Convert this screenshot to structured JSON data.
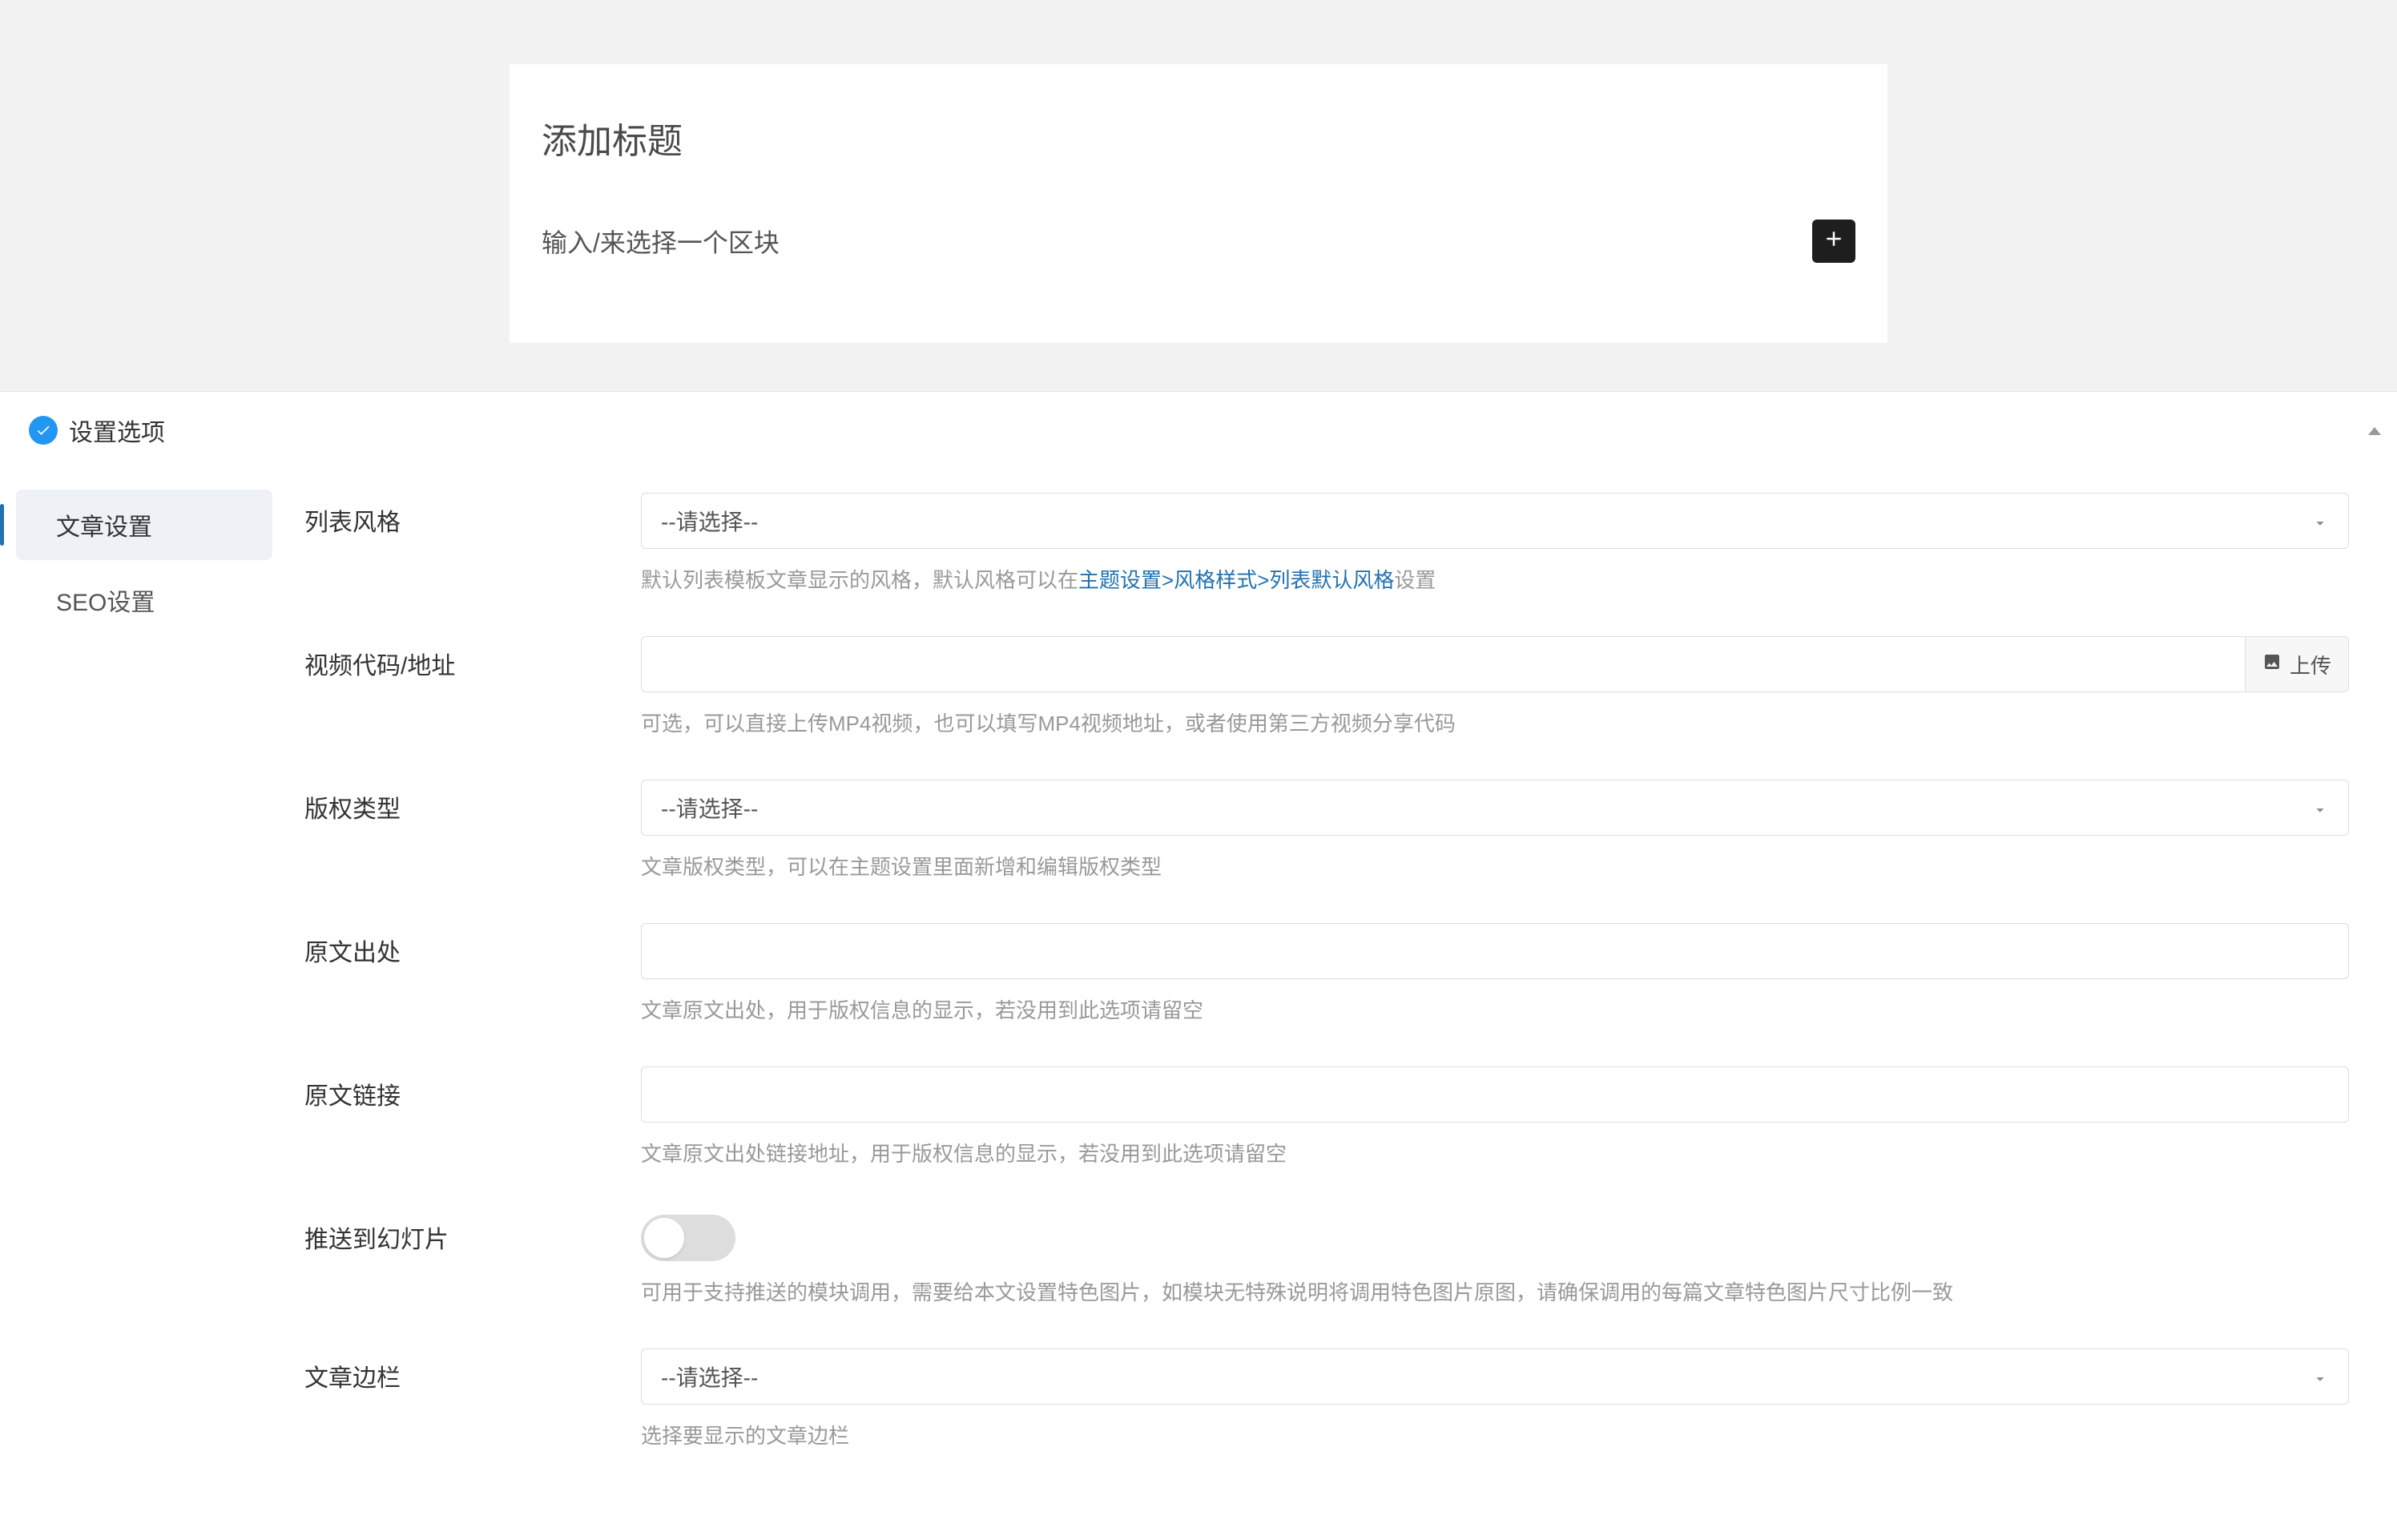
{
  "editor": {
    "title_placeholder": "添加标题",
    "block_placeholder": "输入/来选择一个区块"
  },
  "settings": {
    "panel_title": "设置选项",
    "nav": [
      {
        "label": "文章设置",
        "active": true
      },
      {
        "label": "SEO设置",
        "active": false
      }
    ],
    "fields": {
      "list_style": {
        "label": "列表风格",
        "placeholder": "--请选择--",
        "help_prefix": "默认列表模板文章显示的风格，默认风格可以在",
        "help_link": "主题设置>风格样式>列表默认风格",
        "help_suffix": "设置"
      },
      "video": {
        "label": "视频代码/地址",
        "upload_label": "上传",
        "help": "可选，可以直接上传MP4视频，也可以填写MP4视频地址，或者使用第三方视频分享代码"
      },
      "copyright": {
        "label": "版权类型",
        "placeholder": "--请选择--",
        "help": "文章版权类型，可以在主题设置里面新增和编辑版权类型"
      },
      "source": {
        "label": "原文出处",
        "help": "文章原文出处，用于版权信息的显示，若没用到此选项请留空"
      },
      "source_link": {
        "label": "原文链接",
        "help": "文章原文出处链接地址，用于版权信息的显示，若没用到此选项请留空"
      },
      "slide": {
        "label": "推送到幻灯片",
        "help": "可用于支持推送的模块调用，需要给本文设置特色图片，如模块无特殊说明将调用特色图片原图，请确保调用的每篇文章特色图片尺寸比例一致"
      },
      "sidebar": {
        "label": "文章边栏",
        "placeholder": "--请选择--",
        "help": "选择要显示的文章边栏"
      }
    }
  }
}
